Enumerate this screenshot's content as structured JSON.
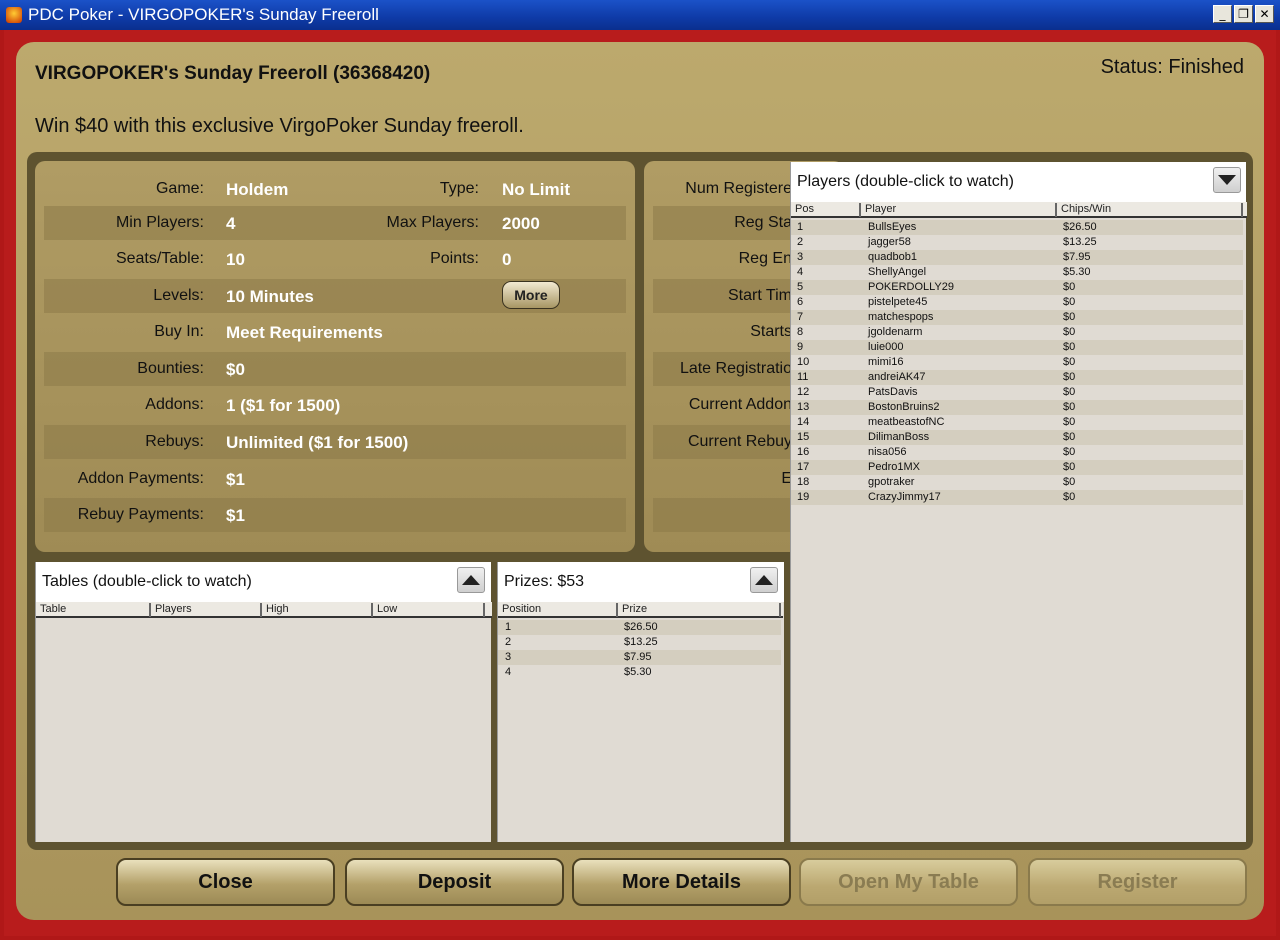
{
  "window": {
    "title": "PDC Poker - VIRGOPOKER's Sunday Freeroll",
    "minimize": "_",
    "maximize": "❐",
    "close": "✕"
  },
  "header": {
    "title": "VIRGOPOKER's Sunday Freeroll (36368420)",
    "status": "Status: Finished",
    "description": "Win $40 with this exclusive VirgoPoker Sunday freeroll."
  },
  "details": {
    "game_label": "Game:",
    "game": "Holdem",
    "type_label": "Type:",
    "type": "No Limit",
    "min_players_label": "Min Players:",
    "min_players": "4",
    "max_players_label": "Max Players:",
    "max_players": "2000",
    "seats_label": "Seats/Table:",
    "seats": "10",
    "points_label": "Points:",
    "points": "0",
    "levels_label": "Levels:",
    "levels": "10 Minutes",
    "more_button": "More",
    "buyin_label": "Buy In:",
    "buyin": "Meet Requirements",
    "bounties_label": "Bounties:",
    "bounties": "$0",
    "addons_label": "Addons:",
    "addons": "1 ($1 for 1500)",
    "rebuys_label": "Rebuys:",
    "rebuys": "Unlimited ($1 for 1500)",
    "addon_payments_label": "Addon Payments:",
    "addon_payments": "$1",
    "rebuy_payments_label": "Rebuy Payments:",
    "rebuy_payments": "$1"
  },
  "schedule": {
    "labels": [
      "Num Registere",
      "Reg Sta",
      "Reg En",
      "Start Tim",
      "Starts",
      "Late Registratio",
      "Current Addon",
      "Current Rebuy",
      "E"
    ]
  },
  "players": {
    "title": "Players (double-click to watch)",
    "columns": [
      "Pos",
      "Player",
      "Chips/Win"
    ],
    "rows": [
      [
        "1",
        "BullsEyes",
        "$26.50"
      ],
      [
        "2",
        "jagger58",
        "$13.25"
      ],
      [
        "3",
        "quadbob1",
        "$7.95"
      ],
      [
        "4",
        "ShellyAngel",
        "$5.30"
      ],
      [
        "5",
        "POKERDOLLY29",
        "$0"
      ],
      [
        "6",
        "pistelpete45",
        "$0"
      ],
      [
        "7",
        "matchespops",
        "$0"
      ],
      [
        "8",
        "jgoldenarm",
        "$0"
      ],
      [
        "9",
        "luie000",
        "$0"
      ],
      [
        "10",
        "mimi16",
        "$0"
      ],
      [
        "11",
        "andreiAK47",
        "$0"
      ],
      [
        "12",
        "PatsDavis",
        "$0"
      ],
      [
        "13",
        "BostonBruins2",
        "$0"
      ],
      [
        "14",
        "meatbeastofNC",
        "$0"
      ],
      [
        "15",
        "DilimanBoss",
        "$0"
      ],
      [
        "16",
        "nisa056",
        "$0"
      ],
      [
        "17",
        "Pedro1MX",
        "$0"
      ],
      [
        "18",
        "gpotraker",
        "$0"
      ],
      [
        "19",
        "CrazyJimmy17",
        "$0"
      ]
    ]
  },
  "tables": {
    "title": "Tables (double-click to watch)",
    "columns": [
      "Table",
      "Players",
      "High",
      "Low"
    ]
  },
  "prizes": {
    "title": "Prizes: $53",
    "columns": [
      "Position",
      "Prize"
    ],
    "rows": [
      [
        "1",
        "$26.50"
      ],
      [
        "2",
        "$13.25"
      ],
      [
        "3",
        "$7.95"
      ],
      [
        "4",
        "$5.30"
      ]
    ]
  },
  "buttons": {
    "close": "Close",
    "deposit": "Deposit",
    "more_details": "More Details",
    "open_my_table": "Open My Table",
    "register": "Register"
  }
}
